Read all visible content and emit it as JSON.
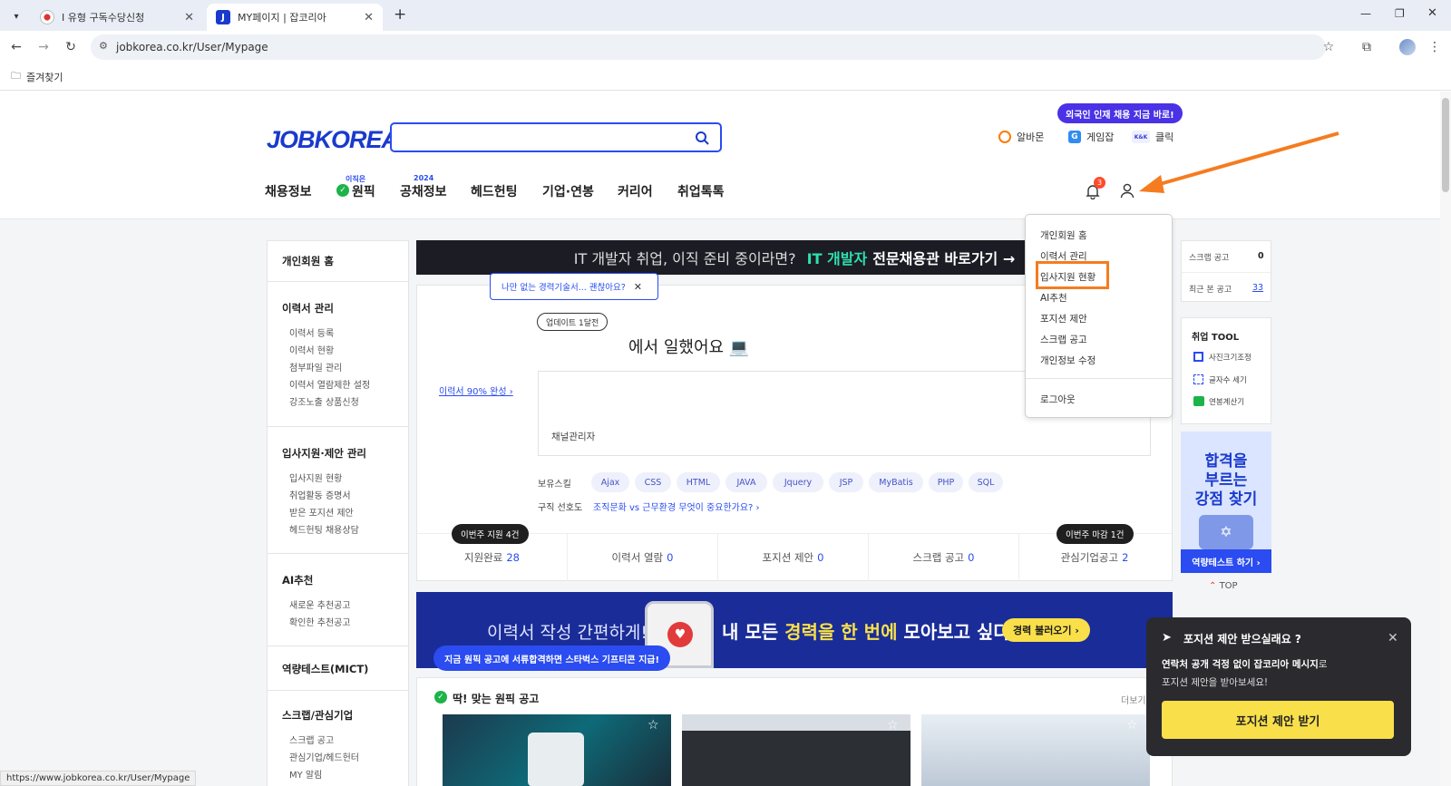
{
  "browser": {
    "tabs": [
      {
        "title": "I 유형 구독수당신청",
        "active": false
      },
      {
        "title": "MY페이지 | 잡코리아",
        "active": true
      }
    ],
    "new_tab": "+",
    "url": "jobkorea.co.kr/User/Mypage",
    "bookmark": "즐겨찾기",
    "status_url": "https://www.jobkorea.co.kr/User/Mypage"
  },
  "header": {
    "logo": "JOBKOREA",
    "search_placeholder": "",
    "foreign_badge": "외국인 인재 채용 지금 바로!",
    "partners": [
      "알바몬",
      "게임잡",
      "클릭"
    ],
    "gnb": [
      {
        "label": "채용정보",
        "sup": ""
      },
      {
        "label": "원픽",
        "sup": "이직은"
      },
      {
        "label": "공채정보",
        "sup": "2024"
      },
      {
        "label": "헤드헌팅",
        "sup": ""
      },
      {
        "label": "기업·연봉",
        "sup": ""
      },
      {
        "label": "커리어",
        "sup": ""
      },
      {
        "label": "취업톡톡",
        "sup": ""
      }
    ],
    "notification_count": "3"
  },
  "sidebar": {
    "home": "개인회원 홈",
    "sections": [
      {
        "title": "이력서 관리",
        "items": [
          "이력서 등록",
          "이력서 현황",
          "첨부파일 관리",
          "이력서 열람제한 설정",
          "강조노출 상품신청"
        ]
      },
      {
        "title": "입사지원·제안 관리",
        "items": [
          "입사지원 현황",
          "취업활동 증명서",
          "받은 포지션 제안",
          "헤드헌팅 채용상담"
        ]
      },
      {
        "title": "AI추천",
        "items": [
          "새로운 추천공고",
          "확인한 추천공고"
        ]
      },
      {
        "title": "역량테스트(MICT)",
        "items": []
      },
      {
        "title": "스크랩/관심기업",
        "items": [
          "스크랩 공고",
          "관심기업/헤드헌터",
          "MY 알림"
        ]
      }
    ]
  },
  "top_banner": {
    "text": "IT 개발자 취업, 이직 준비 중이라면?",
    "highlight": "IT 개발자",
    "cta": "전문채용관 바로가기 →"
  },
  "profile": {
    "tooltip": "나만 없는 경력기술서... 괜찮아요?",
    "update_badge": "업데이트 1달전",
    "worked_text": "에서 일했어요",
    "resume_link": "이력서 90% 완성 ›",
    "role": "채널관리자",
    "skills_label": "보유스킬",
    "skills": [
      "Ajax",
      "CSS",
      "HTML",
      "JAVA",
      "Jquery",
      "JSP",
      "MyBatis",
      "PHP",
      "SQL"
    ],
    "pref_label": "구직 선호도",
    "pref_link": "조직문화 vs 근무환경 무엇이 중요한가요? ›",
    "week_apply_badge": "이번주 지원 4건",
    "week_deadline_badge": "이번주 마감 1건",
    "stats": [
      {
        "label": "지원완료",
        "value": "28"
      },
      {
        "label": "이력서 열람",
        "value": "0"
      },
      {
        "label": "포지션 제안",
        "value": "0"
      },
      {
        "label": "스크랩 공고",
        "value": "0"
      },
      {
        "label": "관심기업공고",
        "value": "2"
      }
    ]
  },
  "mid_banner": {
    "left": "이력서 작성 간편하게!",
    "main_a": "내 모든 ",
    "main_hl": "경력을 한 번에",
    "main_b": " 모아보고 싶다면?",
    "cta": "경력 불러오기 ›"
  },
  "blue_bubble": "지금 원픽 공고에 서류합격하면 스타벅스 기프티콘 지급!",
  "picks": {
    "title": "딱! 맞는 원픽 공고",
    "more": "더보기"
  },
  "right": {
    "scrap_label": "스크랩 공고",
    "scrap_value": "0",
    "recent_label": "최근 본 공고",
    "recent_value": "33",
    "tool_title": "취업 TOOL",
    "tools": [
      "사진크기조정",
      "글자수 세기",
      "연봉계산기"
    ],
    "ad_lines": [
      "합격을",
      "부르는",
      "강점 찾기"
    ],
    "ad_cta": "역량테스트 하기 ›",
    "top": "TOP"
  },
  "dropdown": {
    "items": [
      "개인회원 홈",
      "이력서 관리",
      "입사지원 현황",
      "AI추천",
      "포지션 제안",
      "스크랩 공고",
      "개인정보 수정"
    ],
    "logout": "로그아웃",
    "highlighted": "입사지원 현황"
  },
  "toast": {
    "title": "포지션 제안 받으실래요 ?",
    "body_bold": "연락처 공개 걱정 없이 잡코리아 메시지",
    "body_rest": "로",
    "body_line2": "포지션 제안을 받아보세요!",
    "button": "포지션 제안 받기"
  },
  "colors": {
    "brand": "#2a4cf0",
    "annotation": "#f57c1f",
    "toast_button": "#f9e04b"
  }
}
